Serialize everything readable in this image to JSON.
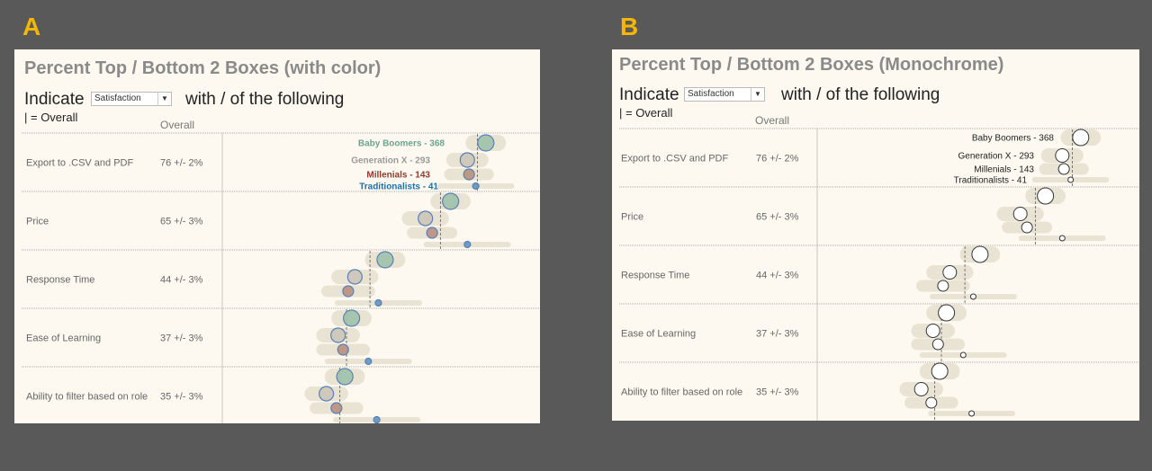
{
  "panels": [
    {
      "letter": "A",
      "title": "Percent Top / Bottom 2 Boxes (with color)",
      "indicate": "Indicate",
      "dropdown_value": "Satisfaction",
      "with_text": "with / of the following",
      "legend": "| = Overall",
      "column_header": "Overall",
      "style": "color"
    },
    {
      "letter": "B",
      "title": "Percent Top / Bottom 2 Boxes (Monochrome)",
      "indicate": "Indicate",
      "dropdown_value": "Satisfaction",
      "with_text": "with / of the following",
      "legend": "| = Overall",
      "column_header": "Overall",
      "style": "monochrome"
    }
  ],
  "colors": {
    "background": "#595959",
    "panel": "#fdf9f0",
    "band": "#e9e3d3",
    "letter": "#f5b800",
    "groups": {
      "Baby Boomers": {
        "fill": "#9fc1ab",
        "label": "#6aa591"
      },
      "Generation X": {
        "fill": "#cbc5b8",
        "label": "#9a9a9a"
      },
      "Millenials": {
        "fill": "#b98f7e",
        "label": "#8b3c2e"
      },
      "Traditionalists": {
        "fill": "#5d96c0",
        "label": "#1f6fa8"
      }
    },
    "outline": "#5a7fb5"
  },
  "chart_data": {
    "type": "scatter",
    "xlim": [
      0,
      95
    ],
    "groups": [
      {
        "name": "Baby Boomers",
        "n": "368"
      },
      {
        "name": "Generation X",
        "n": "293"
      },
      {
        "name": "Millenials",
        "n": "143"
      },
      {
        "name": "Traditionalists",
        "n": "41"
      }
    ],
    "rows": [
      {
        "label": "Export to .CSV and PDF",
        "overall": 76,
        "overall_text": "76 +/- 2%",
        "values": [
          78.5,
          73,
          73.5,
          75.5
        ],
        "ci": [
          6,
          6.3,
          7.4,
          11.5
        ]
      },
      {
        "label": "Price",
        "overall": 65,
        "overall_text": "65 +/- 3%",
        "values": [
          68,
          60.5,
          62.5,
          73
        ],
        "ci": [
          6,
          7,
          7.5,
          13
        ]
      },
      {
        "label": "Response Time",
        "overall": 44,
        "overall_text": "44 +/- 3%",
        "values": [
          48.5,
          39.5,
          37.5,
          46.5
        ],
        "ci": [
          6,
          7,
          8,
          13
        ]
      },
      {
        "label": "Ease of Learning",
        "overall": 37,
        "overall_text": "37 +/- 3%",
        "values": [
          38.5,
          34.5,
          36,
          43.5
        ],
        "ci": [
          6,
          6.5,
          8,
          13
        ]
      },
      {
        "label": "Ability to filter based on role",
        "overall": 35,
        "overall_text": "35 +/- 3%",
        "values": [
          36.5,
          31,
          34,
          46
        ],
        "ci": [
          6,
          6.5,
          8,
          13
        ]
      }
    ]
  }
}
